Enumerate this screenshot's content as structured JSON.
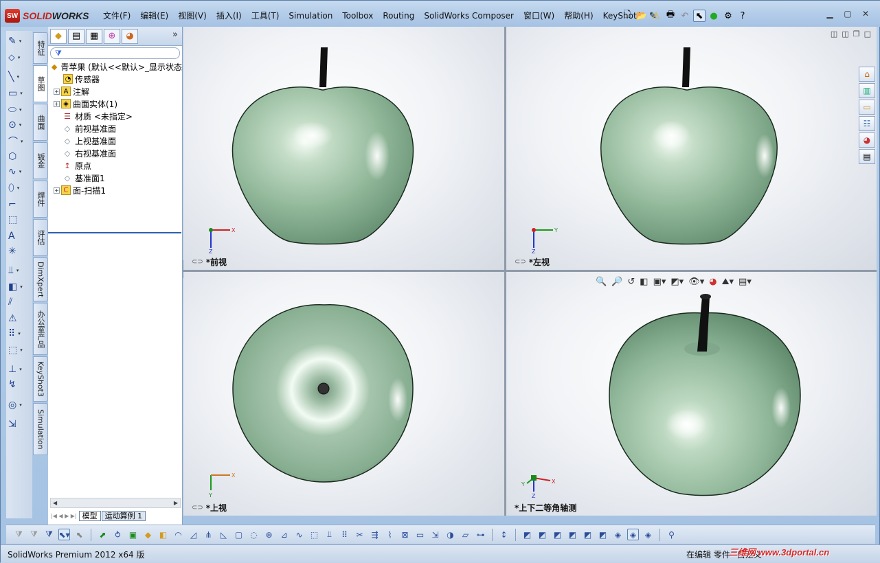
{
  "app": {
    "logo_abbrev": "SW",
    "logo_text_a": "SOLID",
    "logo_text_b": "WORKS"
  },
  "menu": [
    "文件(F)",
    "编辑(E)",
    "视图(V)",
    "插入(I)",
    "工具(T)",
    "Simulation",
    "Toolbox",
    "Routing",
    "SolidWorks Composer",
    "窗口(W)",
    "帮助(H)",
    "KeyShot3"
  ],
  "command_tabs": [
    "特征",
    "草图",
    "曲面",
    "钣金",
    "焊件",
    "评估",
    "DimXpert",
    "办公室产品",
    "KeyShot3",
    "Simulation"
  ],
  "tree": {
    "root": "青苹果  (默认<<默认>_显示状态",
    "items": [
      {
        "label": "传感器",
        "icon": "sensor-icon",
        "expand": false
      },
      {
        "label": "注解",
        "icon": "annotation-icon",
        "expand": true
      },
      {
        "label": "曲面实体(1)",
        "icon": "surface-body-icon",
        "expand": true
      },
      {
        "label": "材质 <未指定>",
        "icon": "material-icon",
        "expand": false
      },
      {
        "label": "前视基准面",
        "icon": "plane-icon",
        "expand": false
      },
      {
        "label": "上视基准面",
        "icon": "plane-icon",
        "expand": false
      },
      {
        "label": "右视基准面",
        "icon": "plane-icon",
        "expand": false
      },
      {
        "label": "原点",
        "icon": "origin-icon",
        "expand": false
      },
      {
        "label": "基准面1",
        "icon": "plane-icon",
        "expand": false
      },
      {
        "label": "面-扫描1",
        "icon": "sweep-icon",
        "expand": true
      }
    ]
  },
  "model_tabs": [
    "模型",
    "运动算例 1"
  ],
  "viewports": {
    "front": {
      "label": "*前视",
      "axis1": "X",
      "axis2": "Z"
    },
    "left": {
      "label": "*左视",
      "axis1": "Y",
      "axis2": "Z"
    },
    "top": {
      "label": "*上视",
      "axis1": "X",
      "axis2": "Y"
    },
    "iso": {
      "label": "*上下二等角轴测",
      "axis1": "X",
      "axis2": "Z",
      "axis3": "Y"
    }
  },
  "status": {
    "left": "SolidWorks Premium 2012 x64 版",
    "editing": "在编辑 零件",
    "custom": "自定义"
  },
  "watermark": "三维网 www.3dportal.cn",
  "colors": {
    "apple_light": "#d8ecd9",
    "apple_mid": "#93bb9c",
    "apple_dark": "#5f8a6a",
    "stem": "#111111",
    "accent": "#2e5fb0"
  }
}
